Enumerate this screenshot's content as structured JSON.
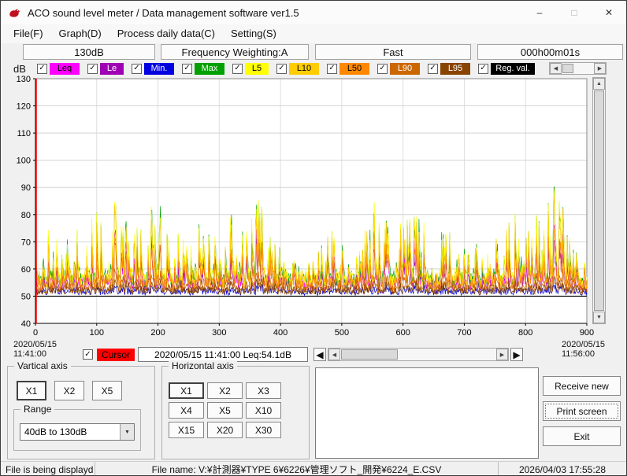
{
  "window": {
    "title": "ACO sound level meter / Data management software ver1.5",
    "controls": {
      "minimize": "–",
      "maximize": "□",
      "close": "✕"
    }
  },
  "menu": {
    "items": [
      {
        "label": "File(F)"
      },
      {
        "label": "Graph(D)"
      },
      {
        "label": "Process daily data(C)"
      },
      {
        "label": "Setting(S)"
      }
    ]
  },
  "header_tabs": [
    "130dB",
    "Frequency Weighting:A",
    "Fast",
    "000h00m01s"
  ],
  "icons": {
    "check": "✓",
    "scroll_left": "◀",
    "scroll_right": "▶",
    "scroll_up": "▲",
    "scroll_down": "▼",
    "dropdown_arrow": "▼",
    "fast_rewind": "◀",
    "fast_forward": "▶"
  },
  "legend": {
    "axis_unit": "dB",
    "items": [
      {
        "label": "Leq",
        "checked": true,
        "color": "#ff00ff",
        "text_color": "#000000"
      },
      {
        "label": "Le",
        "checked": true,
        "color": "#a000b4",
        "text_color": "#ffffff"
      },
      {
        "label": "Min.",
        "checked": true,
        "color": "#0000e0",
        "text_color": "#ffffff"
      },
      {
        "label": "Max",
        "checked": true,
        "color": "#00a000",
        "text_color": "#ffffff"
      },
      {
        "label": "L5",
        "checked": true,
        "color": "#ffff00",
        "text_color": "#000000"
      },
      {
        "label": "L10",
        "checked": true,
        "color": "#ffcc00",
        "text_color": "#000000"
      },
      {
        "label": "L50",
        "checked": true,
        "color": "#ff8800",
        "text_color": "#000000"
      },
      {
        "label": "L90",
        "checked": true,
        "color": "#cc6600",
        "text_color": "#ffffff"
      },
      {
        "label": "L95",
        "checked": true,
        "color": "#884400",
        "text_color": "#ffffff"
      },
      {
        "label": "Reg. val.",
        "checked": true,
        "color": "#000000",
        "text_color": "#ffffff"
      }
    ]
  },
  "chart": {
    "start": {
      "date": "2020/05/15",
      "time": "11:41:00"
    },
    "end": {
      "date": "2020/05/15",
      "time": "11:56:00"
    }
  },
  "chart_data": {
    "type": "line",
    "title": "Sound level time history",
    "ylabel": "dB",
    "ylim": [
      40,
      130
    ],
    "ytick_step": 10,
    "xlim": [
      0,
      900
    ],
    "xtick_step": 100,
    "grid": true,
    "cursor_x": 0,
    "regulation_value": 50,
    "noise_seed": 20200515,
    "peak_envelope": [
      [
        0,
        76
      ],
      [
        25,
        74
      ],
      [
        55,
        72
      ],
      [
        90,
        79
      ],
      [
        125,
        86
      ],
      [
        150,
        78
      ],
      [
        175,
        74
      ],
      [
        200,
        90
      ],
      [
        215,
        73
      ],
      [
        240,
        74
      ],
      [
        265,
        77
      ],
      [
        290,
        71
      ],
      [
        320,
        80
      ],
      [
        345,
        74
      ],
      [
        365,
        86
      ],
      [
        385,
        70
      ],
      [
        405,
        67
      ],
      [
        430,
        61
      ],
      [
        455,
        63
      ],
      [
        480,
        75
      ],
      [
        505,
        68
      ],
      [
        530,
        72
      ],
      [
        550,
        86
      ],
      [
        570,
        81
      ],
      [
        590,
        76
      ],
      [
        615,
        79
      ],
      [
        640,
        80
      ],
      [
        665,
        73
      ],
      [
        690,
        74
      ],
      [
        715,
        70
      ],
      [
        735,
        67
      ],
      [
        760,
        73
      ],
      [
        785,
        81
      ],
      [
        805,
        74
      ],
      [
        830,
        85
      ],
      [
        845,
        91
      ],
      [
        860,
        86
      ],
      [
        875,
        68
      ],
      [
        900,
        62
      ]
    ],
    "series": [
      {
        "name": "Leq",
        "color": "#ff00ff",
        "base": 51.5,
        "band": 5.0,
        "scale": 0.6,
        "seed": 11
      },
      {
        "name": "Le",
        "color": "#a000b4",
        "base": 51.2,
        "band": 4.5,
        "scale": 0.5,
        "seed": 22
      },
      {
        "name": "Min.",
        "color": "#0000e0",
        "base": 50.2,
        "band": 2.2,
        "scale": 0.08,
        "seed": 33
      },
      {
        "name": "Max",
        "color": "#00a000",
        "base": 52.2,
        "band": 6.0,
        "scale": 0.93,
        "seed": 44
      },
      {
        "name": "L5",
        "color": "#ffff00",
        "base": 52.2,
        "band": 6.0,
        "scale": 0.95,
        "seed": 55
      },
      {
        "name": "L10",
        "color": "#ffcc00",
        "base": 51.8,
        "band": 5.5,
        "scale": 0.86,
        "seed": 66
      },
      {
        "name": "L50",
        "color": "#ff8800",
        "base": 51.3,
        "band": 4.8,
        "scale": 0.55,
        "seed": 77
      },
      {
        "name": "L90",
        "color": "#cc6600",
        "base": 50.7,
        "band": 3.2,
        "scale": 0.2,
        "seed": 88
      },
      {
        "name": "L95",
        "color": "#884400",
        "base": 50.4,
        "band": 2.6,
        "scale": 0.12,
        "seed": 99
      },
      {
        "name": "Reg. val.",
        "color": "#000000",
        "flat": true,
        "value": 50
      }
    ]
  },
  "cursor_bar": {
    "label": "Cursor",
    "checked": true,
    "readout": "2020/05/15 11:41:00 Leq:54.1dB"
  },
  "panels": {
    "vertical_axis": {
      "title": "Vartical axis",
      "buttons": [
        "X1",
        "X2",
        "X5"
      ],
      "active": "X1"
    },
    "range": {
      "title": "Range",
      "value": "40dB to 130dB"
    },
    "horizontal_axis": {
      "title": "Horizontal axis",
      "buttons": [
        "X1",
        "X2",
        "X3",
        "X4",
        "X5",
        "X10",
        "X15",
        "X20",
        "X30"
      ],
      "active": "X1"
    }
  },
  "actions": {
    "receive_new": "Receive new",
    "print_screen": "Print screen",
    "exit": "Exit"
  },
  "status_bar": {
    "left": "File is being displayd",
    "center": "File name: V:¥計測器¥TYPE 6¥6226¥管理ソフト_開発¥6224_E.CSV",
    "right": "2026/04/03 17:55:28"
  }
}
